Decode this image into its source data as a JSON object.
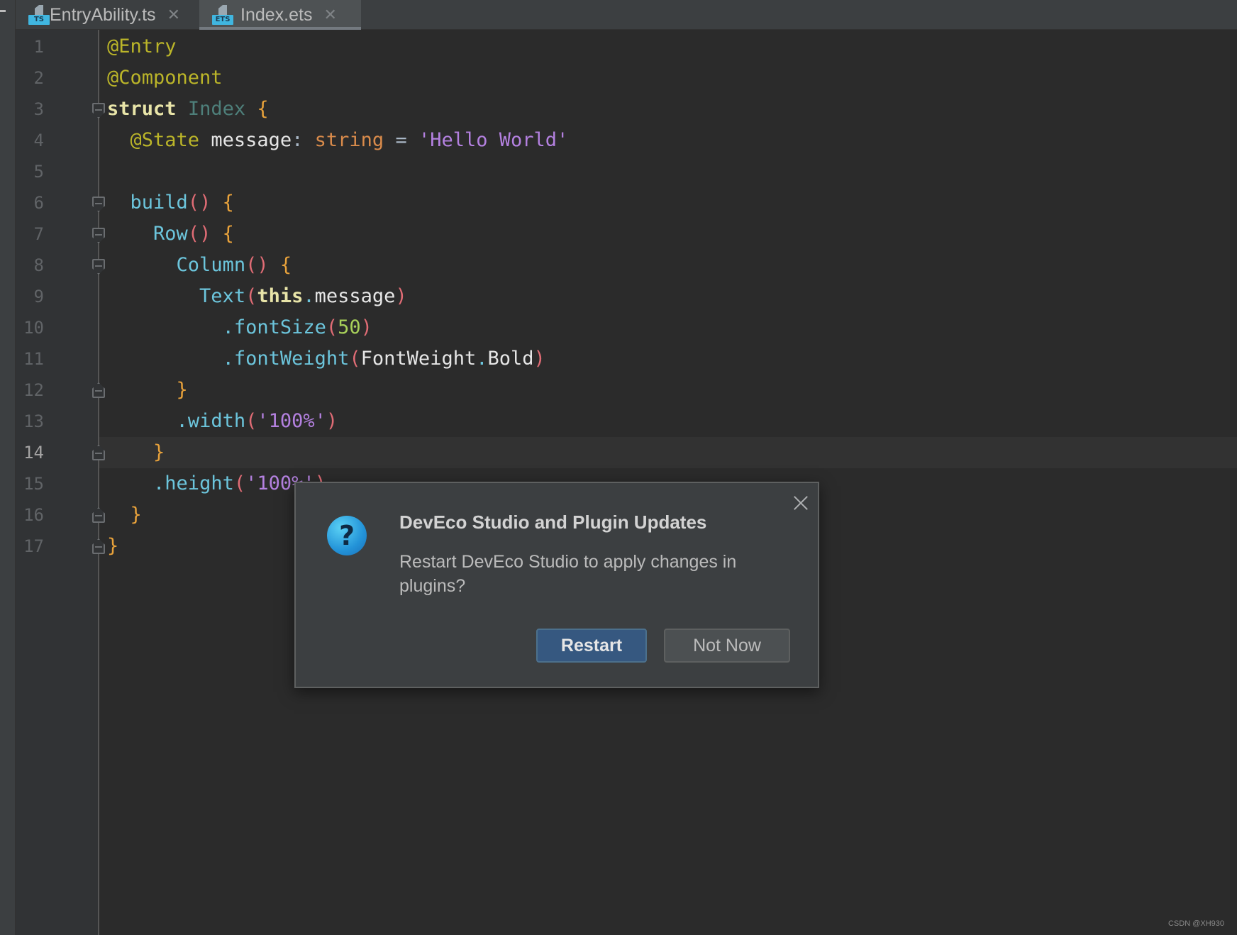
{
  "tabs": [
    {
      "label": "EntryAbility.ts",
      "icon": "ts-file-icon",
      "badge": "TS",
      "close": "✕",
      "active": false
    },
    {
      "label": "Index.ets",
      "icon": "ets-file-icon",
      "badge": "ETS",
      "close": "✕",
      "active": true
    }
  ],
  "editor": {
    "current_line": 14,
    "line_numbers": [
      "1",
      "2",
      "3",
      "4",
      "5",
      "6",
      "7",
      "8",
      "9",
      "10",
      "11",
      "12",
      "13",
      "14",
      "15",
      "16",
      "17"
    ],
    "lines": [
      "@Entry",
      "@Component",
      "struct Index {",
      "  @State message: string = 'Hello World'",
      "",
      "  build() {",
      "    Row() {",
      "      Column() {",
      "        Text(this.message)",
      "          .fontSize(50)",
      "          .fontWeight(FontWeight.Bold)",
      "      }",
      "      .width('100%')",
      "    }",
      "    .height('100%')",
      "  }",
      "}"
    ]
  },
  "dialog": {
    "title": "DevEco Studio and Plugin Updates",
    "message": "Restart DevEco Studio to apply changes in plugins?",
    "icon": "question-icon",
    "icon_glyph": "?",
    "primary_button": "Restart",
    "secondary_button": "Not Now"
  },
  "watermark": "CSDN @XH930",
  "colors": {
    "editor_bg": "#2b2b2b",
    "gutter_bg": "#313335",
    "annotation": "#bbb529",
    "string": "#b481e0",
    "function": "#6cc5dc",
    "brace": "#e8a23b",
    "number": "#a8d05a",
    "primary_button": "#365880"
  }
}
